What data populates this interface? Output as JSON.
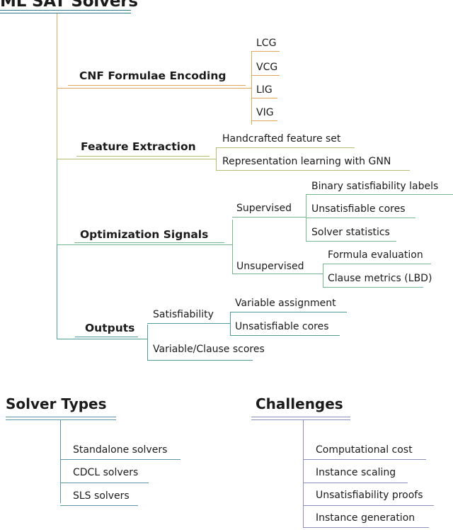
{
  "diagram": {
    "type": "mind-map",
    "root": {
      "label": "ML SAT Solvers",
      "color": "#2b7a8c"
    },
    "branches": [
      {
        "label": "CNF Formulae Encoding",
        "color": "#e2a55c",
        "children": [
          {
            "label": "LCG"
          },
          {
            "label": "VCG"
          },
          {
            "label": "LIG"
          },
          {
            "label": "VIG"
          }
        ]
      },
      {
        "label": "Feature Extraction",
        "color": "#b6bd71",
        "children": [
          {
            "label": "Handcrafted feature set"
          },
          {
            "label": "Representation learning with GNN"
          }
        ]
      },
      {
        "label": "Optimization Signals",
        "color": "#74b88f",
        "children": [
          {
            "label": "Supervised",
            "children": [
              {
                "label": "Binary satisfiability labels"
              },
              {
                "label": "Unsatisfiable cores"
              },
              {
                "label": "Solver statistics"
              }
            ]
          },
          {
            "label": "Unsupervised",
            "children": [
              {
                "label": "Formula evaluation"
              },
              {
                "label": "Clause metrics (LBD)"
              }
            ]
          }
        ]
      },
      {
        "label": "Outputs",
        "color": "#4d9d9a",
        "children": [
          {
            "label": "Satisfiability",
            "children": [
              {
                "label": "Variable assignment"
              },
              {
                "label": "Unsatisfiable cores"
              }
            ]
          },
          {
            "label": "Variable/Clause scores"
          }
        ]
      }
    ],
    "sections": [
      {
        "title": "Solver Types",
        "color": "#5b95ab",
        "items": [
          {
            "label": "Standalone solvers"
          },
          {
            "label": "CDCL solvers"
          },
          {
            "label": "SLS solvers"
          }
        ]
      },
      {
        "title": "Challenges",
        "color": "#8a8fc0",
        "items": [
          {
            "label": "Computational cost"
          },
          {
            "label": "Instance scaling"
          },
          {
            "label": "Unsatisfiability proofs"
          },
          {
            "label": "Instance generation"
          }
        ]
      }
    ]
  }
}
